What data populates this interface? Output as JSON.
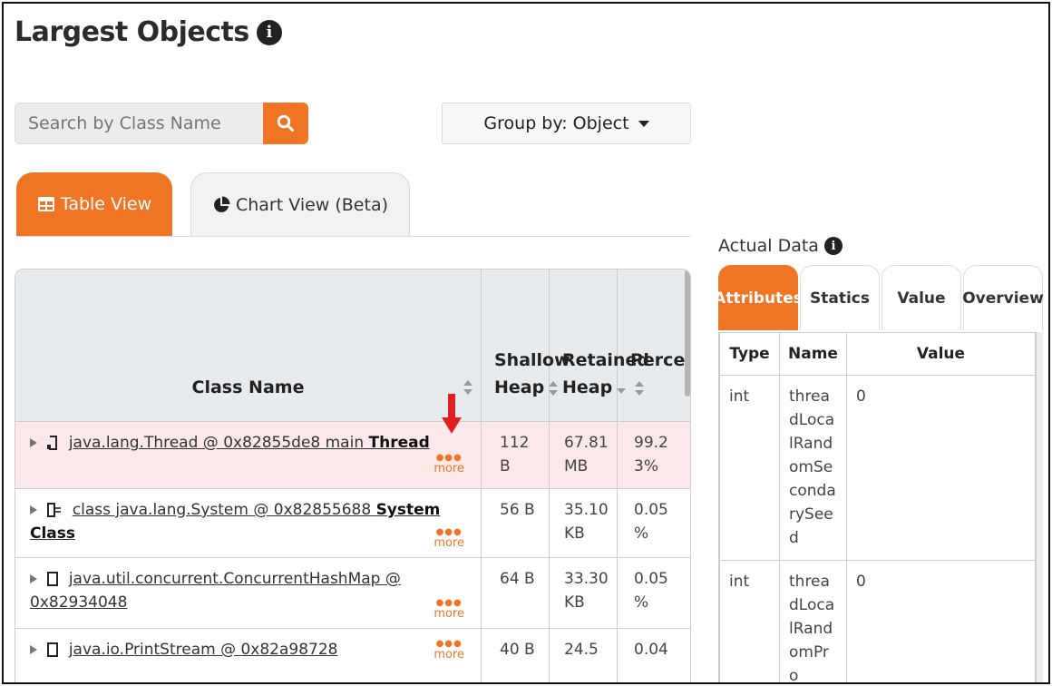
{
  "page": {
    "title": "Largest Objects",
    "info_glyph": "i"
  },
  "search": {
    "placeholder": "Search by Class Name"
  },
  "group_by": {
    "label": "Group by: Object"
  },
  "view_tabs": {
    "table": "Table View",
    "chart": "Chart View (Beta)"
  },
  "table": {
    "headers": {
      "class_name": "Class Name",
      "shallow_heap": "Shallow Heap",
      "retained_heap": "Retained Heap",
      "percent": "Percent"
    },
    "rows": [
      {
        "class_text": "java.lang.Thread @ 0x82855de8 main ",
        "class_bold": "Thread",
        "shallow": "112 B",
        "retained": "67.81 MB",
        "percent": "99.23%",
        "more": "more"
      },
      {
        "class_text": "class java.lang.System @ 0x82855688 ",
        "class_bold": "System Class",
        "shallow": "56 B",
        "retained": "35.10 KB",
        "percent": "0.05 %",
        "more": "more"
      },
      {
        "class_text": "java.util.concurrent.ConcurrentHashMap @ 0x82934048",
        "class_bold": "",
        "shallow": "64 B",
        "retained": "33.30 KB",
        "percent": "0.05 %",
        "more": "more"
      },
      {
        "class_text": "java.io.PrintStream @ 0x82a98728",
        "class_bold": "",
        "shallow": "40 B",
        "retained": "24.5",
        "percent": "0.04",
        "more": "more"
      }
    ]
  },
  "actual_data": {
    "title": "Actual Data",
    "tabs": [
      "Attributes",
      "Statics",
      "Value",
      "Overview"
    ],
    "headers": {
      "type": "Type",
      "name": "Name",
      "value": "Value"
    },
    "rows": [
      {
        "type": "int",
        "name": "threadLocalRandomSecondarySeed",
        "value": "0"
      },
      {
        "type": "int",
        "name": "threadLocalRandomPro",
        "value": "0"
      }
    ]
  },
  "colors": {
    "accent": "#ef7524",
    "highlight_row": "#fbe9e9",
    "arrow": "#e02020"
  }
}
